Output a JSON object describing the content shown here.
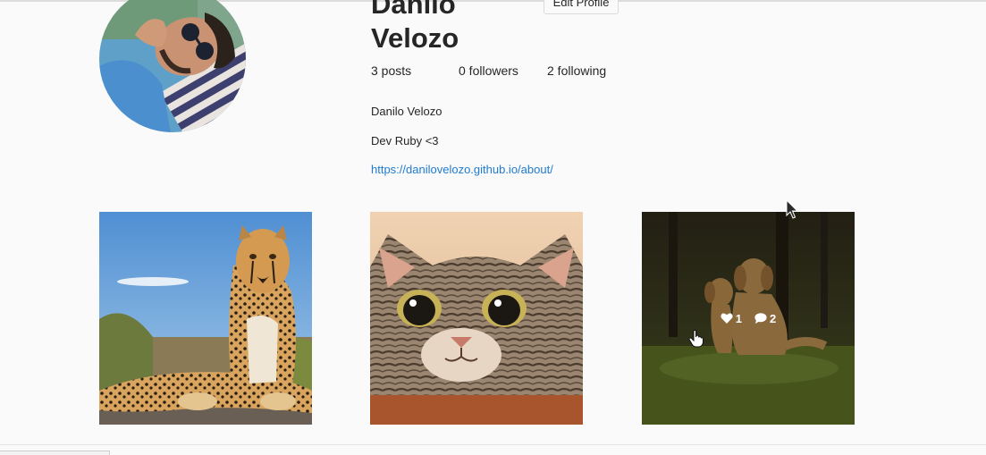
{
  "profile": {
    "username_line1": "Danilo",
    "username_line2": "Velozo",
    "edit_button": "Edit Profile",
    "stats": {
      "posts": "3 posts",
      "followers": "0 followers",
      "following": "2 following"
    },
    "full_name": "Danilo Velozo",
    "bio": "Dev Ruby <3",
    "website": "https://danilovelozo.github.io/about/"
  },
  "posts": [
    {
      "subject": "cheetah"
    },
    {
      "subject": "cat"
    },
    {
      "subject": "dogs",
      "likes": "1",
      "comments": "2"
    }
  ],
  "colors": {
    "link": "#1f7bd1",
    "background": "#fafafa",
    "text": "#262626"
  }
}
